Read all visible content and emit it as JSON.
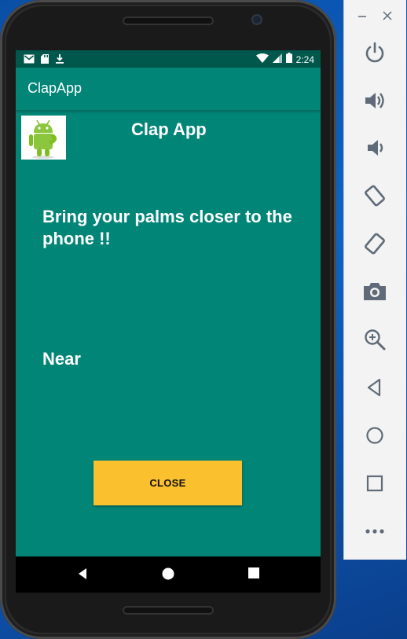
{
  "status_bar": {
    "time": "2:24"
  },
  "app_bar": {
    "title": "ClapApp"
  },
  "main": {
    "heading": "Clap App",
    "instruction": "Bring your palms closer to the phone !!",
    "proximity_state": "Near",
    "close_label": "CLOSE"
  },
  "colors": {
    "primary": "#008577",
    "primary_dark": "#00574B",
    "button": "#FBC02D",
    "toolbar_icon": "#5f6b78"
  },
  "emulator_toolbar": {
    "icons": [
      "minimize-icon",
      "close-icon",
      "power-icon",
      "volume-up-icon",
      "volume-down-icon",
      "rotate-left-icon",
      "rotate-right-icon",
      "camera-icon",
      "zoom-icon",
      "back-icon",
      "home-icon",
      "overview-icon",
      "more-icon"
    ]
  }
}
